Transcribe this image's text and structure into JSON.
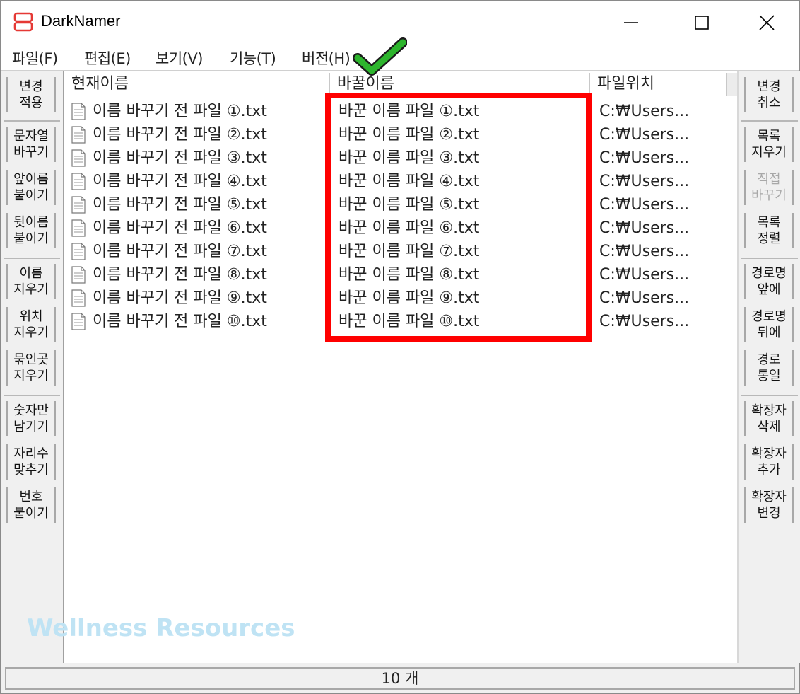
{
  "window": {
    "title": "DarkNamer"
  },
  "menu": [
    "파일(F)",
    "편집(E)",
    "보기(V)",
    "기능(T)",
    "버전(H)"
  ],
  "left_buttons": [
    {
      "label": "변경\n적용",
      "enabled": true
    },
    {
      "label": "문자열\n바꾸기",
      "enabled": true
    },
    {
      "label": "앞이름\n붙이기",
      "enabled": true
    },
    {
      "label": "뒷이름\n붙이기",
      "enabled": true
    },
    {
      "label": "이름\n지우기",
      "enabled": true
    },
    {
      "label": "위치\n지우기",
      "enabled": true
    },
    {
      "label": "묶인곳\n지우기",
      "enabled": true
    },
    {
      "label": "숫자만\n남기기",
      "enabled": true
    },
    {
      "label": "자리수\n맞추기",
      "enabled": true
    },
    {
      "label": "번호\n붙이기",
      "enabled": true
    }
  ],
  "right_buttons": [
    {
      "label": "변경\n취소",
      "enabled": true
    },
    {
      "label": "목록\n지우기",
      "enabled": true
    },
    {
      "label": "직접\n바꾸기",
      "enabled": false
    },
    {
      "label": "목록\n정렬",
      "enabled": true
    },
    {
      "label": "경로명\n앞에",
      "enabled": true
    },
    {
      "label": "경로명\n뒤에",
      "enabled": true
    },
    {
      "label": "경로\n통일",
      "enabled": true
    },
    {
      "label": "확장자\n삭제",
      "enabled": true
    },
    {
      "label": "확장자\n추가",
      "enabled": true
    },
    {
      "label": "확장자\n변경",
      "enabled": true
    }
  ],
  "columns": {
    "current": "현재이름",
    "new": "바꿀이름",
    "location": "파일위치"
  },
  "files": [
    {
      "current": "이름 바꾸기 전 파일 ①.txt",
      "new": "바꾼 이름 파일 ①.txt",
      "location": "C:₩Users..."
    },
    {
      "current": "이름 바꾸기 전 파일 ②.txt",
      "new": "바꾼 이름 파일 ②.txt",
      "location": "C:₩Users..."
    },
    {
      "current": "이름 바꾸기 전 파일 ③.txt",
      "new": "바꾼 이름 파일 ③.txt",
      "location": "C:₩Users..."
    },
    {
      "current": "이름 바꾸기 전 파일 ④.txt",
      "new": "바꾼 이름 파일 ④.txt",
      "location": "C:₩Users..."
    },
    {
      "current": "이름 바꾸기 전 파일 ⑤.txt",
      "new": "바꾼 이름 파일 ⑤.txt",
      "location": "C:₩Users..."
    },
    {
      "current": "이름 바꾸기 전 파일 ⑥.txt",
      "new": "바꾼 이름 파일 ⑥.txt",
      "location": "C:₩Users..."
    },
    {
      "current": "이름 바꾸기 전 파일 ⑦.txt",
      "new": "바꾼 이름 파일 ⑦.txt",
      "location": "C:₩Users..."
    },
    {
      "current": "이름 바꾸기 전 파일 ⑧.txt",
      "new": "바꾼 이름 파일 ⑧.txt",
      "location": "C:₩Users..."
    },
    {
      "current": "이름 바꾸기 전 파일 ⑨.txt",
      "new": "바꾼 이름 파일 ⑨.txt",
      "location": "C:₩Users..."
    },
    {
      "current": "이름 바꾸기 전 파일 ⑩.txt",
      "new": "바꾼 이름 파일 ⑩.txt",
      "location": "C:₩Users..."
    }
  ],
  "status": {
    "count": "10 개"
  },
  "watermark": "Wellness Resources",
  "icons": {
    "app": "darknamer-app-icon",
    "minimize": "minimize-icon",
    "maximize": "maximize-icon",
    "close": "close-icon",
    "file": "text-file-icon",
    "annotation": "check-mark-icon"
  },
  "colors": {
    "annotation_box": "#ff0000",
    "checkmark": "#2db52d",
    "app_icon": "#e53935"
  }
}
